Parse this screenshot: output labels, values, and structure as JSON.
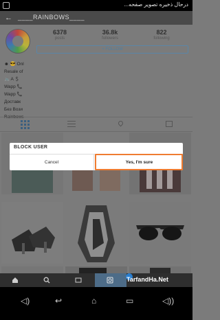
{
  "status_bar": {
    "text": "درحال ذخیره تصویر صفحه..."
  },
  "top_bar": {
    "username": "____RAINBOWS____"
  },
  "profile": {
    "stats": [
      {
        "value": "6378",
        "label": "posts"
      },
      {
        "value": "36.8k",
        "label": "followers"
      },
      {
        "value": "822",
        "label": "following"
      }
    ],
    "follow_label": "+ FOLLOW",
    "bio_lines": [
      "☻ 😎 Onl",
      "Resale of",
      "🚲 A ＄",
      "Wapp 📞",
      "Wapp 📞",
      "Доставк",
      "Без Вози",
      "Rainbows"
    ]
  },
  "dialog": {
    "title": "BLOCK USER",
    "cancel_label": "Cancel",
    "confirm_label": "Yes, I'm sure"
  },
  "bottom_nav": {
    "active": "camera"
  },
  "watermark": {
    "text": "TarfandHa.Net"
  },
  "colors": {
    "highlight": "#ef7c31",
    "link": "#4f7fa2",
    "active_tab": "#4d6c88"
  }
}
